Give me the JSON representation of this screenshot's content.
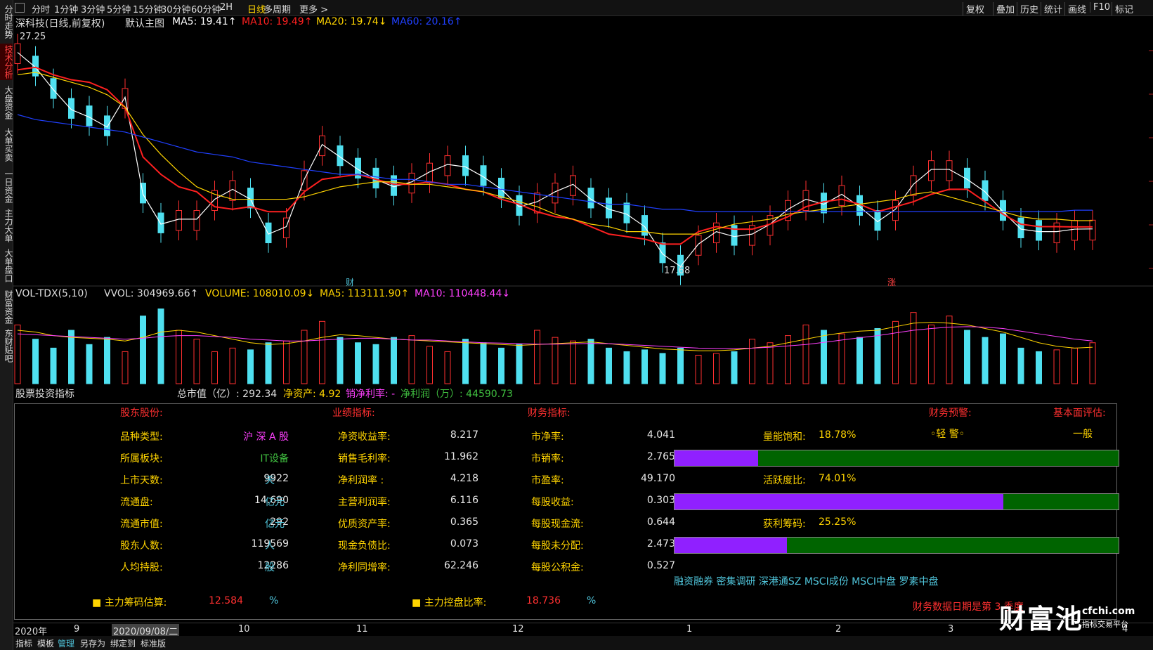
{
  "left_tabs": [
    "分时走势",
    "技术分析",
    "大盘资金",
    "大单买卖",
    "一日资金",
    "主力大单",
    "大单盘口",
    "财富资金",
    "东财贴吧"
  ],
  "toolbar": {
    "periods": [
      "分时",
      "1分钟",
      "3分钟",
      "5分钟",
      "15分钟",
      "30分钟",
      "60分钟",
      "2H",
      "日线",
      "多周期",
      "更多 >"
    ],
    "selected": "日线",
    "right": [
      "复权",
      "叠加",
      "历史",
      "统计",
      "画线",
      "F10",
      "标记"
    ]
  },
  "main_chart": {
    "title": "深科技(日线,前复权)",
    "template": "默认主图",
    "ma5": "MA5: 19.41↑",
    "ma10": "MA10: 19.49↑",
    "ma20": "MA20: 19.74↓",
    "ma60": "MA60: 20.16↑",
    "high_label": "27.25",
    "low_label": "17.68",
    "marker1": "财",
    "marker2": "涨",
    "colors": {
      "ma5": "#ffffff",
      "ma10": "#ff2020",
      "ma20": "#ffd400",
      "ma60": "#2040ff",
      "up": "#ff3030",
      "down": "#4fe0f0"
    }
  },
  "chart_data": [
    {
      "type": "line",
      "title": "深科技(日线,前复权)",
      "x_axis": [
        "2020年",
        "9",
        "2020/09/08/二",
        "10",
        "11",
        "12",
        "1",
        "2",
        "3",
        "4"
      ],
      "ylim": [
        17.68,
        27.25
      ],
      "series": [
        {
          "name": "MA5",
          "values": [
            26.5,
            25.9,
            25.0,
            24.2,
            23.9,
            23.5,
            24.7,
            20.8,
            19.6,
            19.8,
            19.8,
            20.6,
            21.0,
            20.6,
            19.2,
            19.5,
            21.4,
            22.8,
            22.3,
            21.8,
            21.4,
            21.1,
            21.3,
            21.7,
            22.0,
            21.9,
            21.5,
            21.0,
            20.3,
            20.5,
            20.9,
            21.2,
            20.6,
            20.2,
            20.0,
            19.5,
            18.4,
            17.9,
            18.8,
            19.3,
            19.1,
            19.2,
            19.6,
            20.2,
            20.6,
            20.4,
            20.8,
            20.3,
            19.7,
            20.2,
            21.2,
            21.8,
            21.8,
            21.4,
            20.9,
            20.1,
            19.4,
            19.3,
            19.3,
            19.4,
            19.41
          ]
        },
        {
          "name": "MA10",
          "values": [
            25.8,
            25.9,
            25.6,
            25.4,
            25.3,
            25.0,
            24.3,
            22.3,
            21.6,
            21.1,
            20.9,
            20.3,
            20.2,
            20.3,
            20.1,
            20.1,
            20.9,
            21.4,
            21.5,
            21.6,
            21.4,
            21.2,
            21.2,
            21.3,
            21.2,
            21.0,
            20.9,
            20.6,
            20.4,
            20.1,
            19.9,
            19.8,
            19.5,
            19.2,
            19.1,
            19.0,
            18.8,
            18.8,
            19.3,
            19.5,
            19.4,
            19.4,
            19.6,
            19.9,
            20.3,
            20.5,
            20.6,
            20.4,
            20.1,
            20.3,
            20.5,
            20.8,
            21.0,
            21.0,
            20.5,
            20.0,
            19.6,
            19.5,
            19.5,
            19.49,
            19.49
          ]
        },
        {
          "name": "MA20",
          "values": [
            25.6,
            25.7,
            25.5,
            25.3,
            25.1,
            24.8,
            24.3,
            23.2,
            22.4,
            21.7,
            21.1,
            20.8,
            20.6,
            20.6,
            20.6,
            20.6,
            20.7,
            20.9,
            21.1,
            21.2,
            21.3,
            21.3,
            21.2,
            21.2,
            21.1,
            21.0,
            20.9,
            20.7,
            20.5,
            20.3,
            20.0,
            19.8,
            19.6,
            19.5,
            19.3,
            19.3,
            19.2,
            19.2,
            19.2,
            19.4,
            19.6,
            19.7,
            19.8,
            20.0,
            20.1,
            20.2,
            20.3,
            20.4,
            20.5,
            20.6,
            20.8,
            20.9,
            20.7,
            20.5,
            20.3,
            20.1,
            19.9,
            19.8,
            19.8,
            19.74,
            19.74
          ]
        },
        {
          "name": "MA60",
          "values": [
            24.0,
            23.8,
            23.7,
            23.6,
            23.5,
            23.4,
            23.3,
            23.1,
            22.9,
            22.7,
            22.5,
            22.4,
            22.3,
            22.1,
            22.0,
            21.9,
            21.8,
            21.7,
            21.6,
            21.6,
            21.5,
            21.4,
            21.4,
            21.3,
            21.2,
            21.2,
            21.1,
            21.0,
            20.9,
            20.8,
            20.7,
            20.6,
            20.5,
            20.4,
            20.4,
            20.3,
            20.2,
            20.2,
            20.1,
            20.1,
            20.1,
            20.1,
            20.1,
            20.1,
            20.1,
            20.1,
            20.1,
            20.1,
            20.1,
            20.1,
            20.1,
            20.1,
            20.1,
            20.1,
            20.1,
            20.1,
            20.1,
            20.1,
            20.1,
            20.16,
            20.16
          ]
        }
      ]
    },
    {
      "type": "bar",
      "title": "VOL-TDX(5,10)",
      "series": [
        {
          "name": "VOLUME",
          "values": [
            330,
            250,
            200,
            300,
            220,
            260,
            180,
            380,
            420,
            300,
            250,
            180,
            200,
            190,
            230,
            240,
            300,
            350,
            260,
            230,
            220,
            260,
            270,
            210,
            180,
            250,
            230,
            200,
            220,
            300,
            260,
            240,
            250,
            200,
            180,
            190,
            170,
            200,
            160,
            170,
            180,
            250,
            230,
            270,
            330,
            300,
            280,
            260,
            310,
            350,
            400,
            330,
            380,
            300,
            260,
            280,
            200,
            180,
            190,
            200,
            230
          ]
        },
        {
          "name": "MA5",
          "values": [
            300,
            290,
            270,
            260,
            255,
            250,
            240,
            260,
            290,
            300,
            290,
            270,
            250,
            230,
            220,
            225,
            240,
            260,
            275,
            270,
            260,
            250,
            245,
            240,
            235,
            230,
            225,
            220,
            215,
            220,
            225,
            230,
            235,
            225,
            215,
            205,
            195,
            190,
            185,
            185,
            190,
            200,
            210,
            230,
            250,
            270,
            285,
            295,
            300,
            320,
            340,
            345,
            340,
            330,
            310,
            290,
            260,
            230,
            210,
            200,
            205
          ]
        },
        {
          "name": "MA10",
          "values": [
            280,
            275,
            270,
            265,
            260,
            255,
            250,
            255,
            265,
            270,
            270,
            265,
            260,
            250,
            245,
            240,
            240,
            245,
            250,
            255,
            255,
            250,
            245,
            245,
            240,
            235,
            230,
            228,
            225,
            222,
            222,
            224,
            226,
            225,
            220,
            215,
            210,
            205,
            200,
            198,
            198,
            200,
            205,
            212,
            220,
            232,
            245,
            258,
            270,
            285,
            300,
            310,
            318,
            320,
            318,
            310,
            295,
            280,
            265,
            250,
            240
          ]
        }
      ]
    }
  ],
  "vol_header": {
    "name": "VOL-TDX(5,10)",
    "vvol": "VVOL: 304969.66↑",
    "volume": "VOLUME: 108010.09↓",
    "ma5": "MA5: 113111.90↑",
    "ma10": "MA10: 110448.44↓"
  },
  "indicator_header": {
    "title": "股票投资指标",
    "cap": "总市值（亿）: 292.34",
    "net_assets": "净资产: 4.92",
    "net_margin": "销净利率: -",
    "net_profit": "净利润（万）: 44590.73"
  },
  "panel": {
    "sections": [
      "股东股份:",
      "业绩指标:",
      "财务指标:",
      "财务预警:",
      "基本面评估:"
    ],
    "warning": "◦轻 警◦",
    "assessment": "一般",
    "col1": [
      {
        "label": "品种类型:",
        "value": "沪 深 A 股",
        "unit": ""
      },
      {
        "label": "所属板块:",
        "value": "IT设备",
        "unit": ""
      },
      {
        "label": "上市天数:",
        "value": "9922",
        "unit": "天"
      },
      {
        "label": "流通盘:",
        "value": "14.690",
        "unit": "亿元"
      },
      {
        "label": "流通市值:",
        "value": "292",
        "unit": "亿元"
      },
      {
        "label": "股东人数:",
        "value": "119569",
        "unit": "人"
      },
      {
        "label": "人均持股:",
        "value": "12286",
        "unit": "股"
      }
    ],
    "col2": [
      {
        "label": "净资收益率:",
        "value": "8.217"
      },
      {
        "label": "销售毛利率:",
        "value": "11.962"
      },
      {
        "label": "净利润率 :",
        "value": "4.218"
      },
      {
        "label": "主营利润率:",
        "value": "6.116"
      },
      {
        "label": "优质资产率:",
        "value": "0.365"
      },
      {
        "label": "现金负债比:",
        "value": "0.073"
      },
      {
        "label": "净利同增率:",
        "value": "62.246"
      }
    ],
    "col3": [
      {
        "label": "市净率:",
        "value": "4.041"
      },
      {
        "label": "市销率:",
        "value": "2.765"
      },
      {
        "label": "市盈率:",
        "value": "49.170"
      },
      {
        "label": "每股收益:",
        "value": "0.303"
      },
      {
        "label": "每股现金流:",
        "value": "0.644"
      },
      {
        "label": "每股未分配:",
        "value": "2.473"
      },
      {
        "label": "每股公积金:",
        "value": "0.527"
      }
    ],
    "gauges": [
      {
        "label": "量能饱和:",
        "value": "18.78%",
        "fraction": 0.1878
      },
      {
        "label": "活跃度比:",
        "value": "74.01%",
        "fraction": 0.7401
      },
      {
        "label": "获利筹码:",
        "value": "25.25%",
        "fraction": 0.2525
      }
    ],
    "tags": "融资融券 密集调研 深港通SZ MSCI成份 MSCI中盘 罗素中盘",
    "chip_est_label": "主力筹码估算:",
    "chip_est_value": "12.584",
    "control_label": "主力控盘比率:",
    "control_value": "18.736",
    "percent": "%",
    "report_date": "财务数据日期是第 3 季度"
  },
  "bottom_tabs": [
    "指标",
    "模板",
    "管理",
    "另存为",
    "绑定到",
    "标准版"
  ],
  "watermark": {
    "main": "财富池",
    "domain": "cfchi.com",
    "sub": "指标交易平台"
  }
}
